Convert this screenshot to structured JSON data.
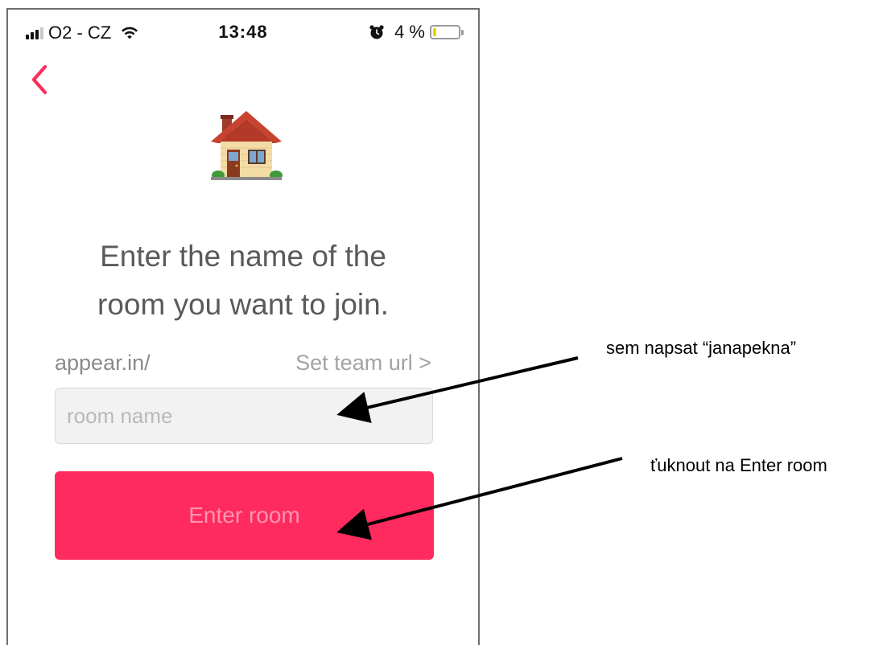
{
  "status_bar": {
    "carrier": "O2 - CZ",
    "time": "13:48",
    "battery_percent": "4 %",
    "battery_level": 0.04
  },
  "icons": {
    "back": "chevron-left-icon",
    "house": "house-icon",
    "alarm": "alarm-clock-icon",
    "wifi": "wifi-icon",
    "signal": "signal-bars-icon"
  },
  "main": {
    "headline_line1": "Enter the name of the",
    "headline_line2": "room you want to join.",
    "domain_prefix": "appear.in/",
    "team_url_link": "Set team url >",
    "room_input": {
      "value": "",
      "placeholder": "room name"
    },
    "enter_button_label": "Enter room"
  },
  "annotations": {
    "input_note": "sem napsat “janapekna”",
    "button_note": "ťuknout na Enter room"
  },
  "colors": {
    "accent": "#ff2b5e",
    "back_chevron": "#ff2b5e",
    "button_text": "#ff95b0",
    "headline_text": "#5a5a5a",
    "input_bg": "#f2f2f2",
    "battery_fill": "#f5d000"
  }
}
